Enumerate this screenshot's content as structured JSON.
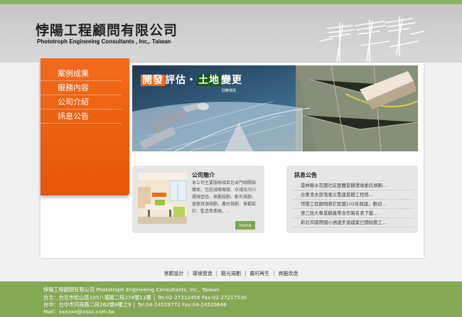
{
  "company": {
    "name_cn": "悖陽工程顧問有限公司",
    "name_en": "Phototroph Engineeing Consultants , Inc,. Taiwan"
  },
  "sidebar": {
    "items": [
      {
        "label": "案例成果"
      },
      {
        "label": "服務內容"
      },
      {
        "label": "公司介紹"
      },
      {
        "label": "訊息公告"
      }
    ]
  },
  "banner": {
    "title_part1": "開發",
    "title_part2": "評估・",
    "title_part3": "土地",
    "title_part4": "變更",
    "subtitle": "回應環境"
  },
  "about": {
    "title": "公司簡介",
    "text": "本公司主要服務項目包含門相關採購案，包括城鄉風貌、水域及河川環境營造、景觀規劃、都市規劃、遊憩資源規劃、農村規劃、景觀設計、監造等業務。...",
    "more_label": "more"
  },
  "news": {
    "title": "訊息公告",
    "items": [
      {
        "text": "雲林縣水花園社區整體景觀環境委託規劃..."
      },
      {
        "text": "台東流水部落風災重建景觀工程將..."
      },
      {
        "text": "悖陽工程顧問將於民國102年興建，歡迎..."
      },
      {
        "text": "第三屆大專景觀產學合作報名表下載..."
      },
      {
        "text": "新北市國際國小週邊步道建案已開始動工..."
      }
    ]
  },
  "bottom_nav": [
    {
      "label": "景觀設計"
    },
    {
      "label": "環境營造"
    },
    {
      "label": "觀光規劃"
    },
    {
      "label": "農村再生"
    },
    {
      "label": "商圈改造"
    }
  ],
  "footer": {
    "line1": "悖陽工程顧問有限公司  Phototroph Engineeing Consultants, Inc,. Taiwan",
    "line2": "台北：台北市松山區105八德路二段274號11樓 │ Tel:02-27212456  Fax:02-27217530",
    "line3": "台中：台中市河南路二段262號8樓之9 │ Tel:04-24529772  Fax:04-24529646",
    "line4": "Mail：xxxxxx@xxxx.com.tw"
  },
  "colors": {
    "accent_orange": "#f26a1b",
    "accent_green": "#84a955"
  }
}
